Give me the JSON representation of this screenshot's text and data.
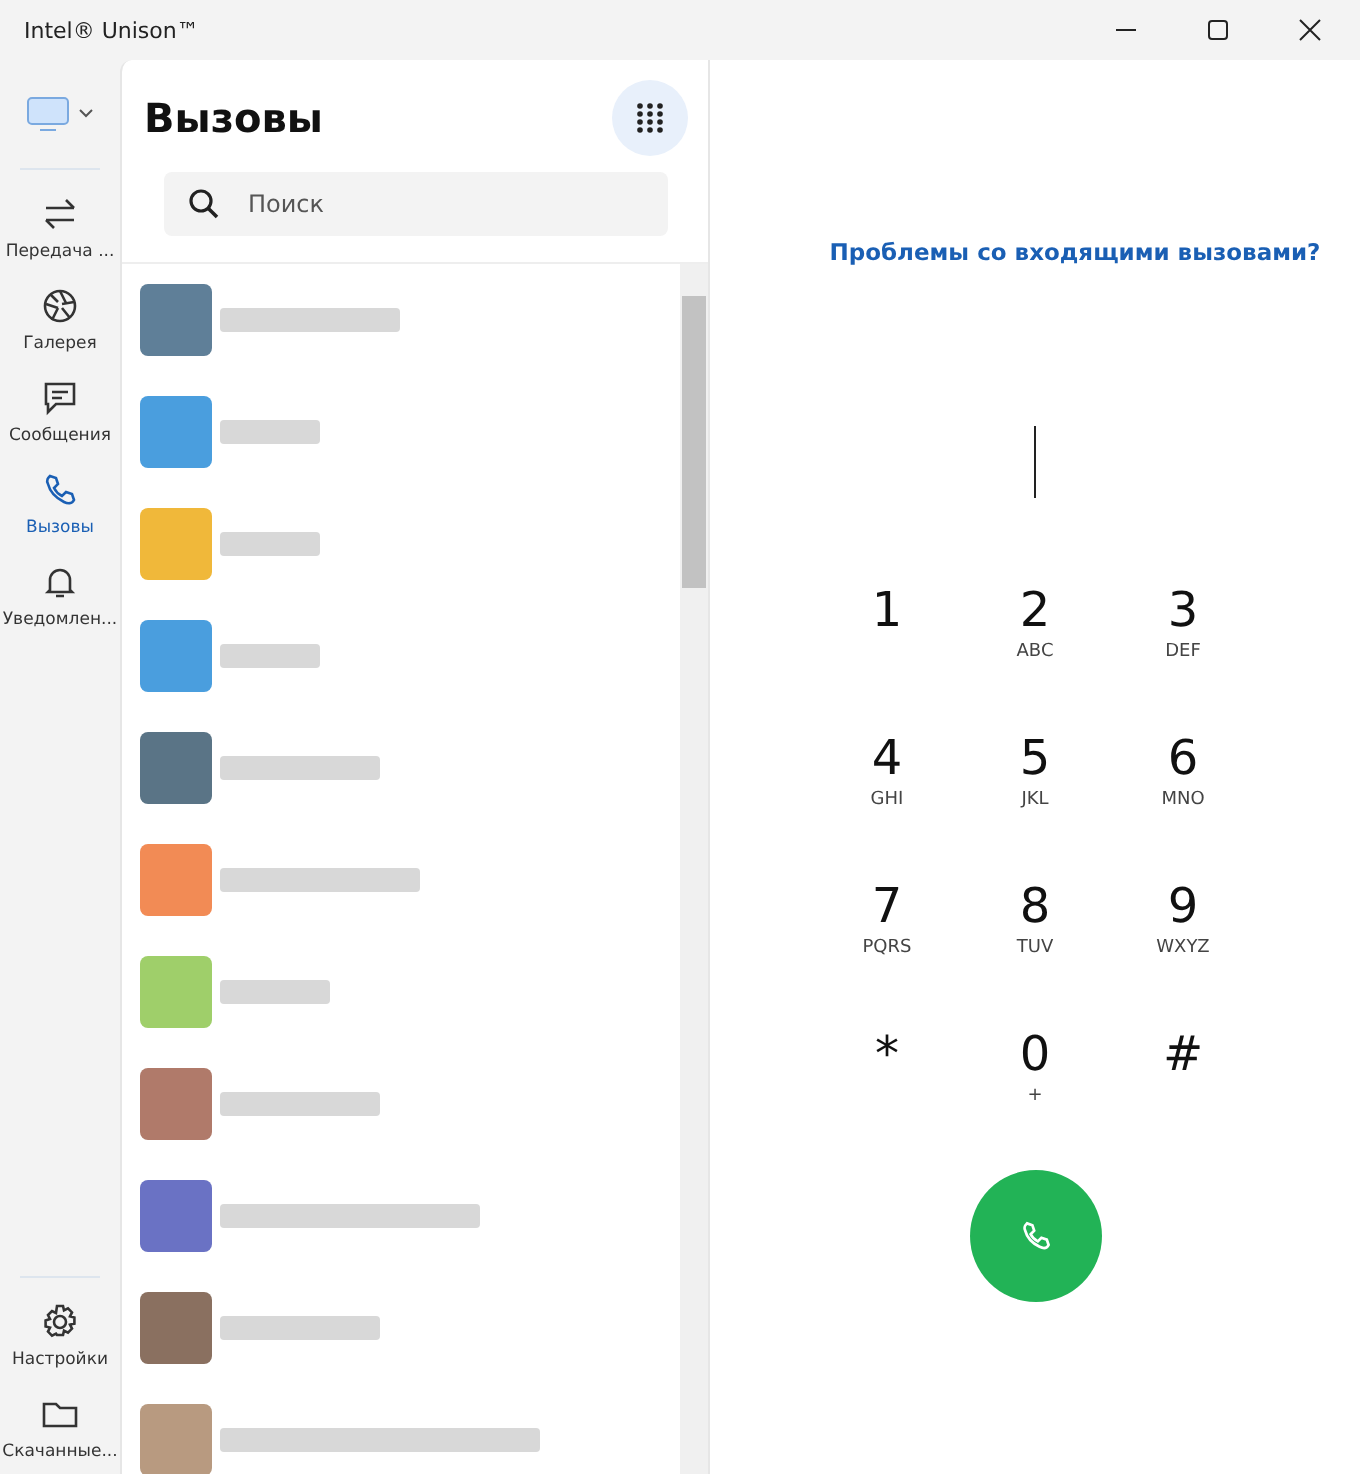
{
  "window": {
    "title": "Intel® Unison™"
  },
  "nav": [
    {
      "label": "Передача ...",
      "kind": "transfer",
      "selected": false
    },
    {
      "label": "Галерея",
      "kind": "gallery",
      "selected": false
    },
    {
      "label": "Сообщения",
      "kind": "messages",
      "selected": false
    },
    {
      "label": "Вызовы",
      "kind": "calls",
      "selected": true
    },
    {
      "label": "Уведомлен...",
      "kind": "notifications",
      "selected": false
    }
  ],
  "nav_bottom": [
    {
      "label": "Настройки",
      "kind": "settings",
      "selected": false
    },
    {
      "label": "Скачанные...",
      "kind": "downloads",
      "selected": false
    }
  ],
  "panel": {
    "title": "Вызовы",
    "search": {
      "placeholder": "Поиск"
    }
  },
  "contacts": [
    {
      "color": "#5f7f98"
    },
    {
      "color": "#4a9ede"
    },
    {
      "color": "#f0b83a"
    },
    {
      "color": "#4a9ede"
    },
    {
      "color": "#5a7486"
    },
    {
      "color": "#f28b55"
    },
    {
      "color": "#9fcf6a"
    },
    {
      "color": "#b07a6a"
    },
    {
      "color": "#6a72c4"
    },
    {
      "color": "#8a7060"
    },
    {
      "color": "#b89a80"
    }
  ],
  "dialer": {
    "help_link": "Проблемы со входящими вызовами?",
    "keys": [
      {
        "digit": "1"
      },
      {
        "digit": "2",
        "letters": "ABC"
      },
      {
        "digit": "3",
        "letters": "DEF"
      },
      {
        "digit": "4",
        "letters": "GHI"
      },
      {
        "digit": "5",
        "letters": "JKL"
      },
      {
        "digit": "6",
        "letters": "MNO"
      },
      {
        "digit": "7",
        "letters": "PQRS"
      },
      {
        "digit": "8",
        "letters": "TUV"
      },
      {
        "digit": "9",
        "letters": "WXYZ"
      },
      {
        "digit": "*"
      },
      {
        "digit": "0",
        "letters": "+"
      },
      {
        "digit": "#"
      }
    ]
  }
}
